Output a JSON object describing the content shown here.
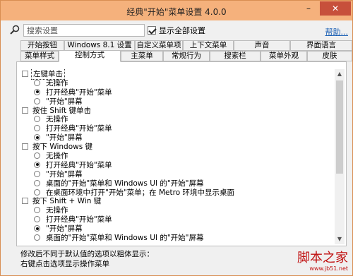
{
  "window": {
    "title": "经典\"开始\"菜单设置 4.0.0",
    "minimize": "–",
    "close": "✕"
  },
  "search": {
    "placeholder": "搜索设置",
    "icon": "search-icon",
    "show_all_label": "显示全部设置",
    "show_all_checked": true,
    "help": "帮助..."
  },
  "tabs_row1": [
    "开始按钮",
    "Windows 8.1 设置",
    "自定义菜单项",
    "上下文菜单",
    "声音",
    "界面语言"
  ],
  "tabs_row2": [
    "菜单样式",
    "控制方式",
    "主菜单",
    "常规行为",
    "搜索栏",
    "菜单外观",
    "皮肤"
  ],
  "active_tab": "控制方式",
  "groups": [
    {
      "label": "左键单击",
      "selected": true,
      "options": [
        {
          "label": "无操作",
          "on": false
        },
        {
          "label": "打开经典\"开始\"菜单",
          "on": true
        },
        {
          "label": "\"开始\"屏幕",
          "on": false
        }
      ]
    },
    {
      "label": "按住 Shift 键单击",
      "selected": false,
      "options": [
        {
          "label": "无操作",
          "on": false
        },
        {
          "label": "打开经典\"开始\"菜单",
          "on": false
        },
        {
          "label": "\"开始\"屏幕",
          "on": true
        }
      ]
    },
    {
      "label": "按下 Windows 键",
      "selected": false,
      "options": [
        {
          "label": "无操作",
          "on": false
        },
        {
          "label": "打开经典\"开始\"菜单",
          "on": true
        },
        {
          "label": "\"开始\"屏幕",
          "on": false
        },
        {
          "label": "桌面的\"开始\"菜单和 Windows UI 的\"开始\"屏幕",
          "on": false
        },
        {
          "label": "在桌面环境中打开\"开始\"菜单；在 Metro 环境中显示桌面",
          "on": false
        }
      ]
    },
    {
      "label": "按下 Shift + Win 键",
      "selected": false,
      "options": [
        {
          "label": "无操作",
          "on": false
        },
        {
          "label": "打开经典\"开始\"菜单",
          "on": false
        },
        {
          "label": "\"开始\"屏幕",
          "on": true
        },
        {
          "label": "桌面的\"开始\"菜单和 Windows UI 的\"开始\"屏幕",
          "on": false
        }
      ]
    }
  ],
  "footer": {
    "line1": "修改后不同于默认值的选项以粗体显示：",
    "line2": "右键点击选项显示操作菜单"
  },
  "watermark": {
    "title": "脚本之家",
    "url": "www.jb51.net"
  }
}
